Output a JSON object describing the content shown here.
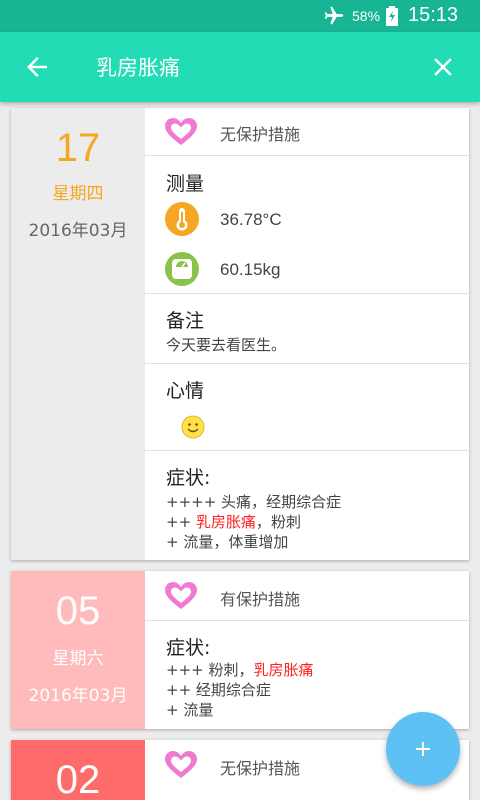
{
  "status_bar": {
    "battery": "58%",
    "time": "15:13"
  },
  "app_bar": {
    "title": "乳房胀痛"
  },
  "cards": [
    {
      "day": "17",
      "weekday": "星期四",
      "year_month": "2016年03月",
      "protection": "无保护措施",
      "measurements": {
        "title": "测量",
        "temperature": "36.78°C",
        "weight": "60.15kg"
      },
      "note": {
        "title": "备注",
        "text": "今天要去看医生。"
      },
      "mood": {
        "title": "心情",
        "icon": "smiley-icon"
      },
      "symptoms": {
        "title": "症状:",
        "lines": [
          {
            "prefix": "++++ ",
            "parts": [
              "头痛",
              "，",
              "经期综合症"
            ]
          },
          {
            "prefix": "++ ",
            "parts": [
              "乳房胀痛",
              "，",
              "粉刺"
            ]
          },
          {
            "prefix": "+ ",
            "parts": [
              "流量",
              "，",
              "体重增加"
            ]
          }
        ]
      }
    },
    {
      "day": "05",
      "weekday": "星期六",
      "year_month": "2016年03月",
      "protection": "有保护措施",
      "symptoms": {
        "title": "症状:",
        "lines": [
          {
            "prefix": "+++ ",
            "parts": [
              "粉刺",
              "，",
              "乳房胀痛"
            ]
          },
          {
            "prefix": "++ ",
            "parts": [
              "经期综合症"
            ]
          },
          {
            "prefix": "+ ",
            "parts": [
              "流量"
            ]
          }
        ]
      }
    },
    {
      "day": "02",
      "protection": "无保护措施"
    }
  ],
  "colors": {
    "status_bar": "#18b595",
    "app_bar": "#22dcb5",
    "heart": "#f07ad0",
    "orange": "#f5a623",
    "green": "#8bc34a",
    "highlight": "#ff2222",
    "fab": "#5ec1f4",
    "card1_date_bg": "#ececec",
    "card2_date_bg": "#ffbbbb",
    "card3_date_bg": "#ff6a6a"
  }
}
